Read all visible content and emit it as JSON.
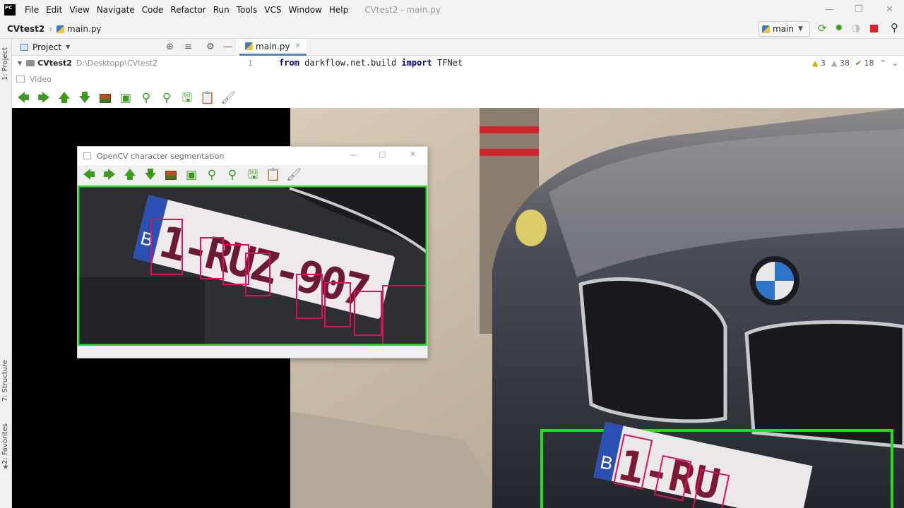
{
  "menubar": {
    "app_logo": "PC",
    "items": [
      "File",
      "Edit",
      "View",
      "Navigate",
      "Code",
      "Refactor",
      "Run",
      "Tools",
      "VCS",
      "Window",
      "Help"
    ],
    "window_title": "CVtest2 - main.py"
  },
  "navbar": {
    "project": "CVtest2",
    "file": "main.py",
    "branch": "main"
  },
  "sidebar": {
    "tab_project": "1: Project",
    "tab_structure": "7: Structure",
    "tab_favorites": "2: Favorites"
  },
  "project_panel": {
    "title": "Project",
    "root_name": "CVtest2",
    "root_path": "D:\\Desktopp\\CVtest2"
  },
  "editor": {
    "tab_label": "main.py",
    "line_number": "1",
    "code_kw1": "from",
    "code_mid": " darkflow.net.build ",
    "code_kw2": "import",
    "code_end": " TFNet",
    "warnings": "3",
    "weak_warnings": "38",
    "typos": "18"
  },
  "video_window": {
    "title": "Video"
  },
  "ocv_window": {
    "title": "OpenCV character segmentation"
  },
  "plate": {
    "country": "B",
    "text_main": "1-RUZ-907",
    "text_crop": "1-RU"
  },
  "colors": {
    "detection_box": "#22dd22",
    "char_box": "#dd1155",
    "toolbar_green": "#3c9a1e"
  },
  "icons": [
    "arrow-left-icon",
    "arrow-right-icon",
    "arrow-up-icon",
    "arrow-down-icon",
    "image-icon",
    "fit-window-icon",
    "zoom-in-icon",
    "zoom-out-icon",
    "save-icon",
    "copy-icon",
    "properties-icon"
  ]
}
